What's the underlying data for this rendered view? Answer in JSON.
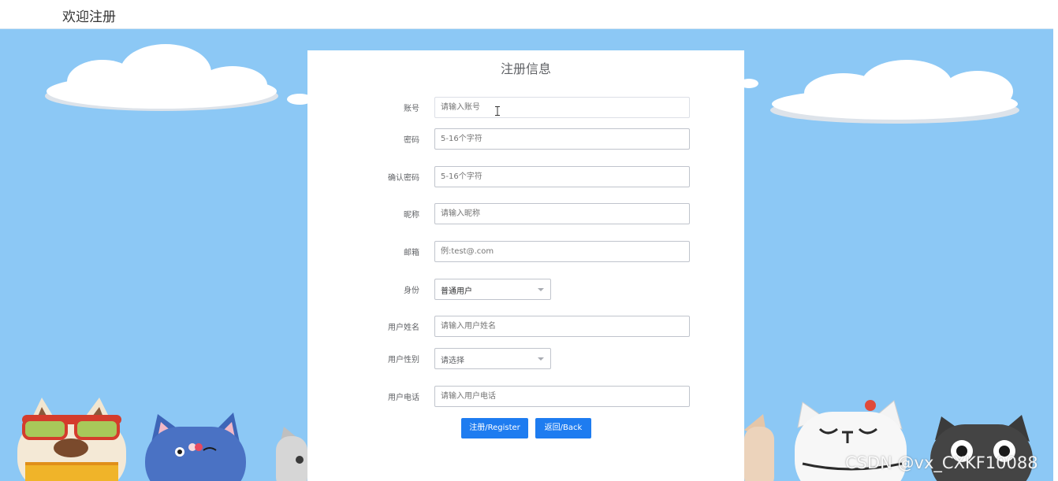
{
  "header": {
    "title": "欢迎注册"
  },
  "form": {
    "title": "注册信息",
    "fields": [
      {
        "label": "账号",
        "placeholder": "请输入账号"
      },
      {
        "label": "密码",
        "placeholder": "5-16个字符"
      },
      {
        "label": "确认密码",
        "placeholder": "5-16个字符"
      },
      {
        "label": "昵称",
        "placeholder": "请输入昵称"
      },
      {
        "label": "邮箱",
        "placeholder": "例:test@.com"
      },
      {
        "label": "身份",
        "selected": "普通用户"
      },
      {
        "label": "用户姓名",
        "placeholder": "请输入用户姓名"
      },
      {
        "label": "用户性别",
        "selected": "请选择"
      },
      {
        "label": "用户电话",
        "placeholder": "请输入用户电话"
      }
    ],
    "buttons": {
      "register": "注册/Register",
      "back": "返回/Back"
    }
  },
  "watermark": "CSDN @vx_CXKF10088",
  "colors": {
    "background": "#8cc8f5",
    "primary": "#1e7cf0",
    "panel": "#ffffff"
  }
}
